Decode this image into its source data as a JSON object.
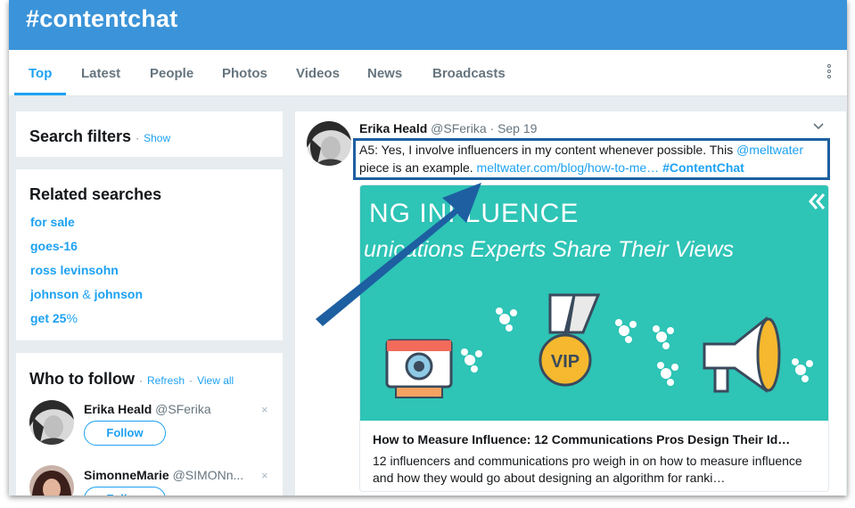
{
  "banner": {
    "title": "#contentchat"
  },
  "nav": {
    "tabs": [
      {
        "label": "Top"
      },
      {
        "label": "Latest"
      },
      {
        "label": "People"
      },
      {
        "label": "Photos"
      },
      {
        "label": "Videos"
      },
      {
        "label": "News"
      },
      {
        "label": "Broadcasts"
      }
    ],
    "more_icon": "vertical-dots-icon"
  },
  "search_filters": {
    "title": "Search filters",
    "separator": "·",
    "show_link": "Show"
  },
  "related_searches": {
    "title": "Related searches",
    "items": [
      {
        "label": "for sale"
      },
      {
        "label": "goes-16"
      },
      {
        "label": "ross levinsohn"
      },
      {
        "label_a": "johnson",
        "label_amp": "&",
        "label_b": "johnson"
      },
      {
        "label_a": "get 25",
        "label_pct": "%"
      }
    ]
  },
  "who_to_follow": {
    "title": "Who to follow",
    "separator": "·",
    "refresh": "Refresh",
    "view_all": "View all",
    "users": [
      {
        "name": "Erika Heald",
        "handle": "@SFerika",
        "button": "Follow",
        "close": "×"
      },
      {
        "name": "SimonneMarie",
        "handle": "@SIMONn...",
        "button": "Follow",
        "close": "×"
      }
    ]
  },
  "tweet": {
    "name": "Erika Heald",
    "handle": "@SFerika",
    "separator": "·",
    "date": "Sep 19",
    "text_part1": "A5: Yes, I involve influencers in my content whenever possible. This ",
    "mention": "@meltwater",
    "text_part2": " piece is an example. ",
    "link": "meltwater.com/blog/how-to-me…",
    "hashtag": "#ContentChat",
    "media": {
      "headline": "NG INFLUENCE",
      "subheadline": "unications Experts Share Their Views",
      "badge": "VIP",
      "title": "How to Measure Influence: 12 Communications Pros Design Their Id…",
      "description": "12 influencers and communications pro weigh in on how to measure influence and how they would go about designing an algorithm for ranki…"
    }
  },
  "colors": {
    "banner": "#3b94d9",
    "accent": "#1da1f2",
    "highlight": "#1d5fa1",
    "media_bg": "#2ec4b6"
  }
}
